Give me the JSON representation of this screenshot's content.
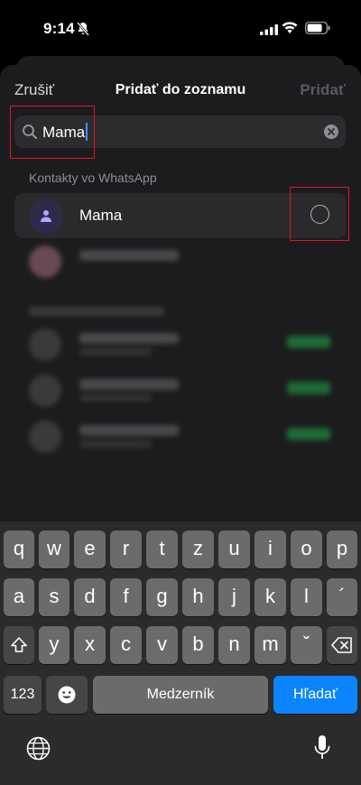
{
  "status_bar": {
    "time": "9:14"
  },
  "nav": {
    "cancel": "Zrušiť",
    "title": "Pridať do zoznamu",
    "add": "Pridať"
  },
  "search": {
    "value": "Mama"
  },
  "section": {
    "label": "Kontakty vo WhatsApp"
  },
  "contacts": [
    {
      "name": "Mama",
      "selected": false
    }
  ],
  "keyboard": {
    "row1": [
      "q",
      "w",
      "e",
      "r",
      "t",
      "z",
      "u",
      "i",
      "o",
      "p"
    ],
    "row2": [
      "a",
      "s",
      "d",
      "f",
      "g",
      "h",
      "j",
      "k",
      "l",
      "´"
    ],
    "row3": [
      "y",
      "x",
      "c",
      "v",
      "b",
      "n",
      "m",
      "ˇ"
    ],
    "numbers_key": "123",
    "space_key": "Medzerník",
    "return_key": "Hľadať"
  },
  "colors": {
    "accent_blue": "#0a84ff",
    "highlight_red": "#e0152a"
  }
}
